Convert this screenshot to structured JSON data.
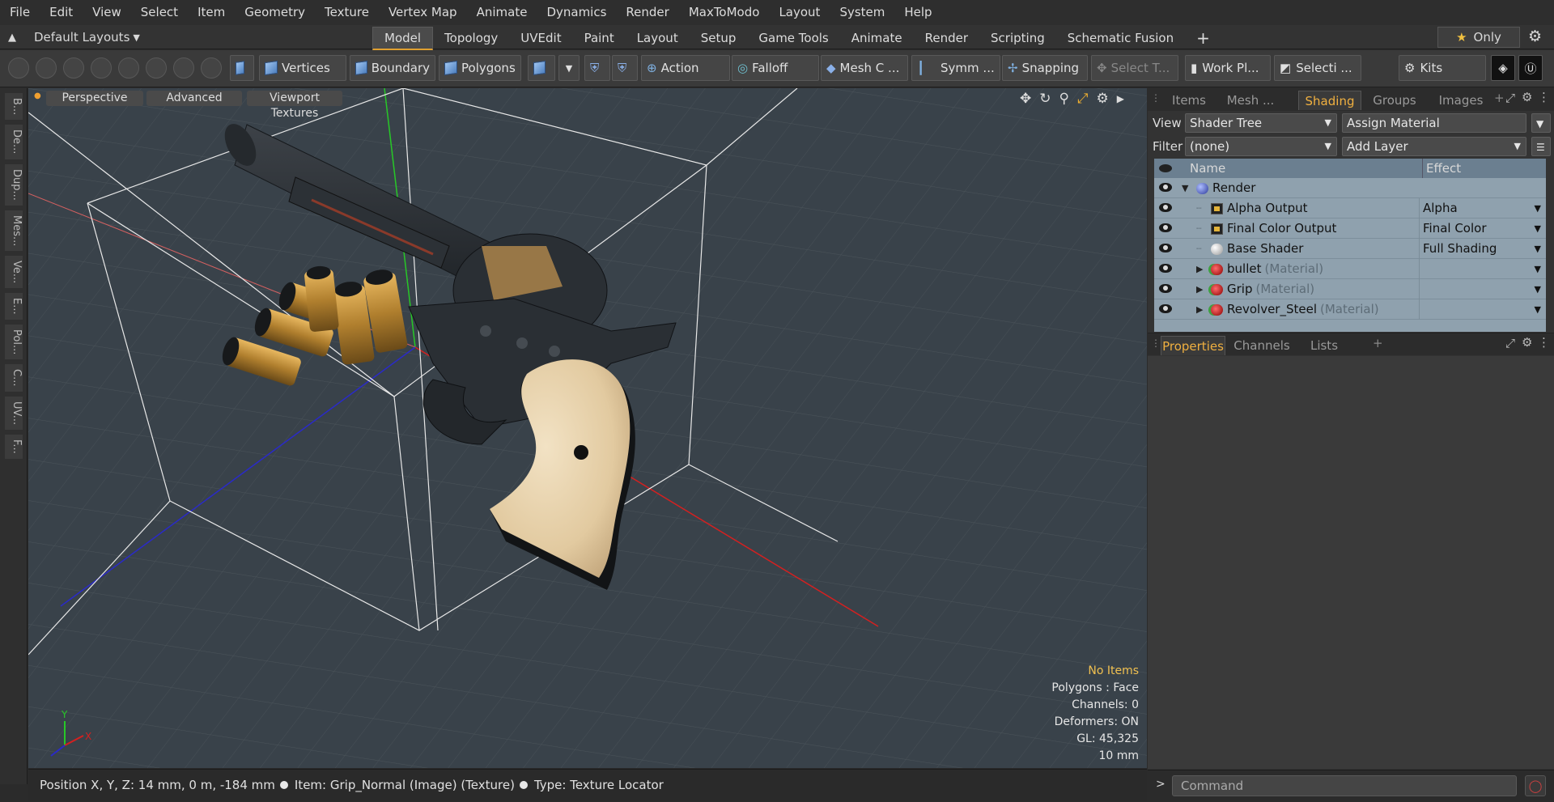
{
  "menu": [
    "File",
    "Edit",
    "View",
    "Select",
    "Item",
    "Geometry",
    "Texture",
    "Vertex Map",
    "Animate",
    "Dynamics",
    "Render",
    "MaxToModo",
    "Layout",
    "System",
    "Help"
  ],
  "layout_selector": "Default Layouts",
  "tabs": [
    "Model",
    "Topology",
    "UVEdit",
    "Paint",
    "Layout",
    "Setup",
    "Game Tools",
    "Animate",
    "Render",
    "Scripting",
    "Schematic Fusion"
  ],
  "active_tab": "Model",
  "only_label": "Only",
  "toolbar": {
    "vertices": "Vertices",
    "boundary": "Boundary",
    "polygons": "Polygons",
    "action": "Action",
    "falloff": "Falloff",
    "mesh": "Mesh C ...",
    "symmetry": "Symm ...",
    "snapping": "Snapping",
    "select_t": "Select T...",
    "work_plane": "Work Pl...",
    "selection": "Selecti ...",
    "kits": "Kits"
  },
  "left_tabs": [
    "B...",
    "De...",
    "Dup...",
    "Mes...",
    "Ve...",
    "E...",
    "Pol...",
    "C...",
    "UV...",
    "F..."
  ],
  "viewport": {
    "perspective": "Perspective",
    "advanced": "Advanced",
    "textures": "Viewport Textures",
    "info": {
      "items": "No Items",
      "polygons": "Polygons : Face",
      "channels": "Channels: 0",
      "deformers": "Deformers: ON",
      "gl": "GL: 45,325",
      "scale": "10 mm"
    },
    "axis_y": "Y",
    "axis_x": "X"
  },
  "status": {
    "position": "Position X, Y, Z:   14 mm, 0 m, -184 mm",
    "item": "Item:  Grip_Normal (Image) (Texture)",
    "type": "Type:  Texture Locator"
  },
  "right_panel": {
    "tabs": [
      "Items",
      "Mesh ...",
      "Shading",
      "Groups",
      "Images"
    ],
    "active_tab": "Shading",
    "view_label": "View",
    "view_value": "Shader Tree",
    "assign_material": "Assign Material",
    "filter_label": "Filter",
    "filter_value": "(none)",
    "add_layer": "Add Layer",
    "columns": {
      "name": "Name",
      "effect": "Effect"
    },
    "rows": [
      {
        "name": "Render",
        "sub": "",
        "effect": "",
        "icon": "sphere",
        "level": 0,
        "expand": "open"
      },
      {
        "name": "Alpha Output",
        "sub": "",
        "effect": "Alpha",
        "icon": "output",
        "level": 1,
        "expand": "none"
      },
      {
        "name": "Final Color Output",
        "sub": "",
        "effect": "Final Color",
        "icon": "output",
        "level": 1,
        "expand": "none"
      },
      {
        "name": "Base Shader",
        "sub": "",
        "effect": "Full Shading",
        "icon": "shader",
        "level": 1,
        "expand": "none"
      },
      {
        "name": "bullet",
        "sub": "(Material)",
        "effect": "",
        "icon": "material",
        "level": 1,
        "expand": "closed"
      },
      {
        "name": "Grip",
        "sub": "(Material)",
        "effect": "",
        "icon": "material",
        "level": 1,
        "expand": "closed"
      },
      {
        "name": "Revolver_Steel",
        "sub": "(Material)",
        "effect": "",
        "icon": "material",
        "level": 1,
        "expand": "closed"
      }
    ],
    "prop_tabs": [
      "Properties",
      "Channels",
      "Lists"
    ],
    "prop_active": "Properties"
  },
  "command_placeholder": "Command"
}
